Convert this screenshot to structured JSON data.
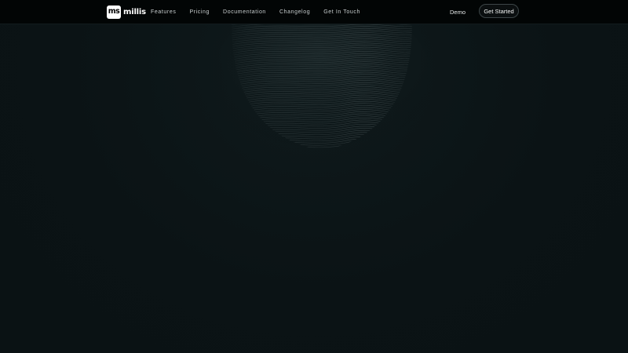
{
  "brand": {
    "mark": "ms",
    "name": "millis"
  },
  "nav": {
    "links": [
      {
        "label": "Features"
      },
      {
        "label": "Pricing"
      },
      {
        "label": "Documentation"
      },
      {
        "label": "Changelog"
      },
      {
        "label": "Get In Touch"
      }
    ],
    "demo_label": "Demo",
    "cta_label": "Get Started"
  },
  "theme": {
    "background": "#0b1315",
    "navbar_background": "#020505",
    "text": "#c9cfd0",
    "accent_line": "#4a5658"
  },
  "hero": {
    "art": "wave-lines-graphic"
  }
}
